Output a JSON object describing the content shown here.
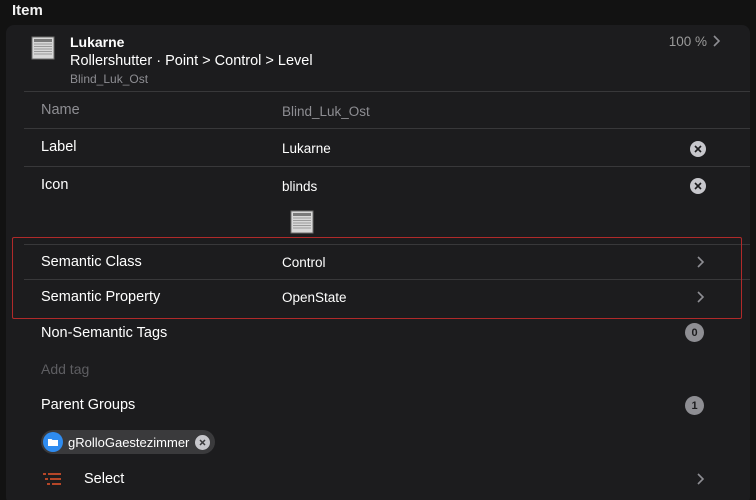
{
  "section": {
    "title": "Item"
  },
  "item": {
    "name": "Lukarne",
    "path": "Rollershutter · Point > Control > Level",
    "sub": "Blind_Luk_Ost",
    "state": "100 %"
  },
  "rows": {
    "name": {
      "label": "Name",
      "value": "Blind_Luk_Ost"
    },
    "label": {
      "label": "Label",
      "value": "Lukarne"
    },
    "icon": {
      "label": "Icon",
      "value": "blinds"
    },
    "semantic_class": {
      "label": "Semantic Class",
      "value": "Control"
    },
    "semantic_property": {
      "label": "Semantic Property",
      "value": "OpenState"
    },
    "non_semantic_tags": {
      "label": "Non-Semantic Tags",
      "count": "0"
    },
    "add_tag": {
      "placeholder": "Add tag"
    },
    "parent_groups": {
      "label": "Parent Groups",
      "count": "1"
    }
  },
  "group_chips": [
    {
      "label": "gRolloGaestezimmer"
    }
  ],
  "select": {
    "label": "Select"
  },
  "colors": {
    "background": "#121212",
    "card": "#1c1c1e",
    "separator": "#38383a",
    "highlight_border": "#b02a2a",
    "chip_icon": "#2f8cf0",
    "select_icon": "#e8552c"
  },
  "icons": {
    "item": "blinds-icon",
    "clear": "clear-icon",
    "chevron": "chevron-right-icon",
    "folder": "folder-icon",
    "select": "list-select-icon"
  }
}
